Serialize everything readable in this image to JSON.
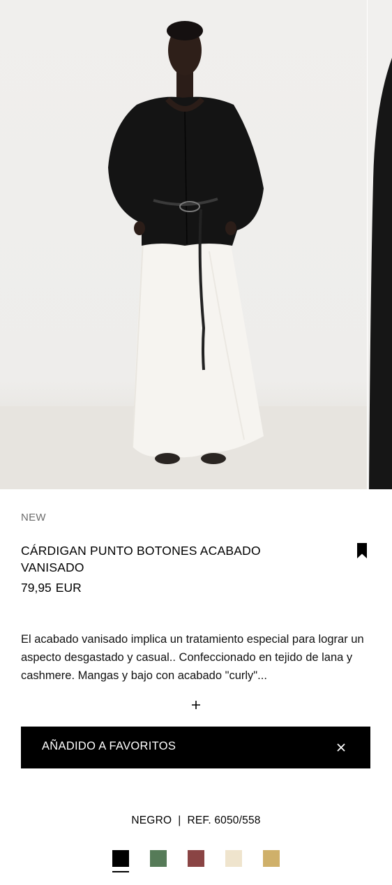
{
  "product": {
    "badge": "NEW",
    "title": "CÁRDIGAN PUNTO BOTONES ACABADO VANISADO",
    "price": "79,95",
    "currency": "EUR",
    "description": "El acabado vanisado implica un tratamiento especial para lograr un aspecto desgastado y casual.. Confeccionado en tejido de lana y cashmere. Mangas y bajo con acabado \"curly\"...",
    "expand_label": "+"
  },
  "toast": {
    "message": "AÑADIDO A FAVORITOS"
  },
  "variant": {
    "color_name": "NEGRO",
    "separator": "|",
    "reference": "REF. 6050/558"
  },
  "swatches": [
    {
      "name": "black",
      "color": "#000000",
      "selected": true
    },
    {
      "name": "green",
      "color": "#567b58",
      "selected": false
    },
    {
      "name": "burgundy",
      "color": "#8a4444",
      "selected": false
    },
    {
      "name": "cream",
      "color": "#efe4cd",
      "selected": false
    },
    {
      "name": "mustard",
      "color": "#cfb06a",
      "selected": false
    }
  ],
  "icons": {
    "favorite": "bookmark-filled-icon",
    "close": "close-icon",
    "expand": "plus-icon"
  }
}
